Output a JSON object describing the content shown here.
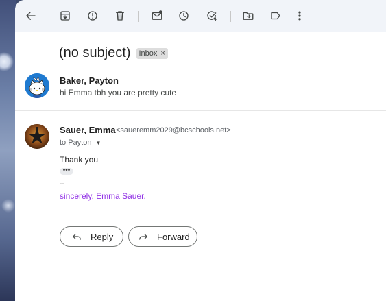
{
  "toolbar": {
    "icons": [
      "back-arrow-icon",
      "archive-icon",
      "report-spam-icon",
      "trash-icon",
      "mark-unread-icon",
      "snooze-icon",
      "add-task-icon",
      "move-to-icon",
      "label-icon",
      "more-vertical-icon"
    ]
  },
  "thread": {
    "subject": "(no subject)",
    "label": "Inbox",
    "label_remove": "×"
  },
  "collapsed_message": {
    "sender": "Baker, Payton",
    "snippet": "hi Emma tbh you are pretty cute",
    "avatar_icon": "hello-kitty-avatar"
  },
  "open_message": {
    "sender": "Sauer, Emma",
    "email": "<saueremm2029@bcschools.net>",
    "to": "to Payton",
    "to_caret": "▼",
    "body": "Thank you",
    "trimmed": "•••",
    "sig_separator": "--",
    "signature": "sincerely, Emma Sauer.",
    "avatar_icon": "star-avatar"
  },
  "actions": {
    "reply": "Reply",
    "forward": "Forward"
  },
  "colors": {
    "toolbar_bg": "#f1f4f9",
    "signature": "#9334e6"
  }
}
